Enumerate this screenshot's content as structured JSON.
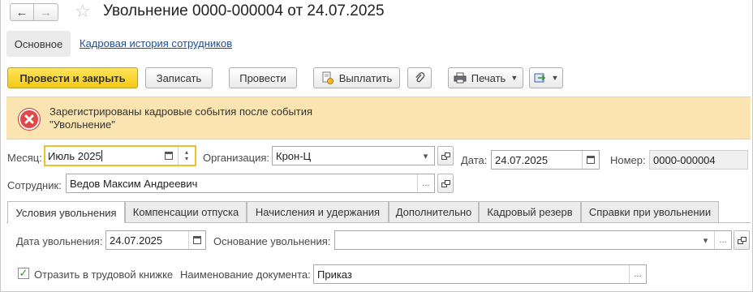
{
  "window": {
    "title": "Увольнение 0000-000004 от 24.07.2025"
  },
  "nav": {
    "back_glyph": "←",
    "forward_glyph": "→",
    "favorite_glyph": "☆"
  },
  "panel": {
    "main_label": "Основное",
    "history_link": "Кадровая история сотрудников"
  },
  "toolbar": {
    "post_close_label": "Провести и закрыть",
    "save_label": "Записать",
    "post_label": "Провести",
    "pay_label": "Выплатить",
    "print_label": "Печать"
  },
  "warning": {
    "line1": "Зарегистрированы кадровые события после события",
    "line2": "\"Увольнение\""
  },
  "header_fields": {
    "month_label": "Месяц:",
    "month_value": "Июль 2025",
    "org_label": "Организация:",
    "org_value": "Крон-Ц",
    "date_label": "Дата:",
    "date_value": "24.07.2025",
    "number_label": "Номер:",
    "number_value": "0000-000004",
    "employee_label": "Сотрудник:",
    "employee_value": "Ведов Максим Андреевич"
  },
  "tabs": [
    {
      "label": "Условия увольнения",
      "active": true
    },
    {
      "label": "Компенсации отпуска"
    },
    {
      "label": "Начисления и удержания"
    },
    {
      "label": "Дополнительно"
    },
    {
      "label": "Кадровый резерв"
    },
    {
      "label": "Справки при увольнении"
    }
  ],
  "conditions": {
    "dismissal_date_label": "Дата увольнения:",
    "dismissal_date_value": "24.07.2025",
    "basis_label": "Основание увольнения:",
    "basis_value": "",
    "workbook_label": "Отразить в трудовой книжке",
    "workbook_checked": true,
    "doc_name_label": "Наименование документа:",
    "doc_name_value": "Приказ"
  },
  "glyphs": {
    "dots": "...",
    "dropdown": "▾",
    "check": "✓"
  },
  "colors": {
    "primary_button": "#f6c913",
    "warning_bg": "#fae4b1",
    "error_icon": "#e04848",
    "link": "#1c4f9c",
    "focus_border": "#f0c02a",
    "checkmark": "#3c8a2e"
  }
}
